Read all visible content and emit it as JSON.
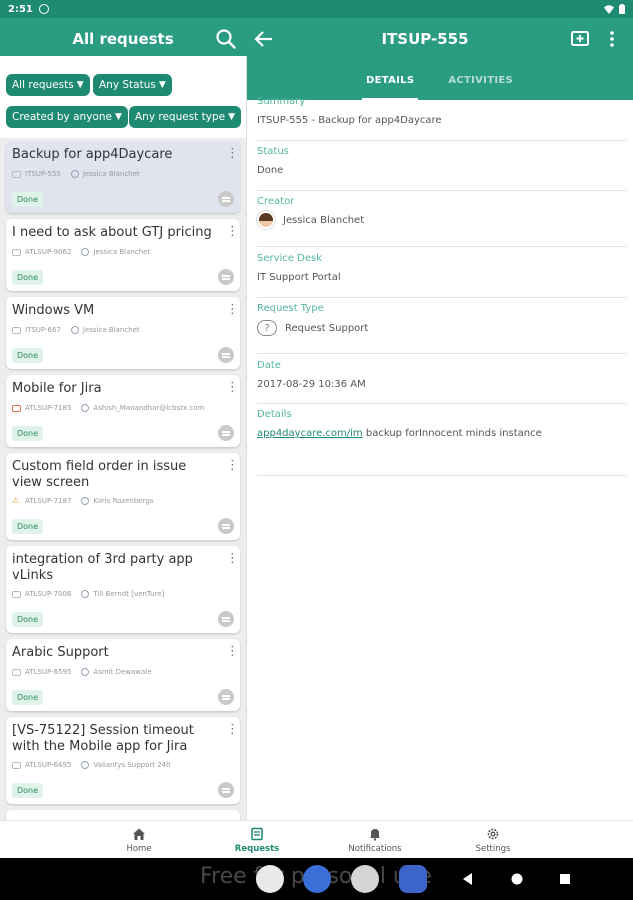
{
  "status_bar": {
    "time": "2:51"
  },
  "list_header": {
    "title": "All requests"
  },
  "detail_header": {
    "title": "ITSUP-555"
  },
  "tabs": [
    {
      "label": "DETAILS",
      "active": true
    },
    {
      "label": "ACTIVITIES",
      "active": false
    }
  ],
  "filters": [
    {
      "label": "All requests"
    },
    {
      "label": "Any Status"
    },
    {
      "label": "Created by anyone"
    },
    {
      "label": "Any request type"
    }
  ],
  "requests": [
    {
      "title": "Backup for app4Daycare",
      "key": "ITSUP-555",
      "person": "Jessica Blanchet",
      "status": "Done",
      "type_icon": "ticket-icon",
      "selected": true
    },
    {
      "title": "I need to ask about GTJ pricing",
      "key": "ATLSUP-9062",
      "person": "Jessica Blanchet",
      "status": "Done",
      "type_icon": "ticket-icon"
    },
    {
      "title": "Windows VM",
      "key": "ITSUP-667",
      "person": "Jessica Blanchet",
      "status": "Done",
      "type_icon": "ticket-icon"
    },
    {
      "title": "Mobile for Jira",
      "key": "ATLSUP-7185",
      "person": "Ashish_Manandhar@lcbstx.com",
      "status": "Done",
      "type_icon": "mail-icon"
    },
    {
      "title": "Custom field order in issue view screen",
      "key": "ATLSUP-7187",
      "person": "Kiiris Rozenbergs",
      "status": "Done",
      "type_icon": "warning-icon"
    },
    {
      "title": "integration of 3rd party app vLinks",
      "key": "ATLSUP-7006",
      "person": "Till Berndt [venTure]",
      "status": "Done",
      "type_icon": "ticket-icon"
    },
    {
      "title": "Arabic Support",
      "key": "ATLSUP-6595",
      "person": "Asmit Dewawale",
      "status": "Done",
      "type_icon": "ticket-icon"
    },
    {
      "title": "[VS-75122] Session timeout with the Mobile app for Jira",
      "key": "ATLSUP-6495",
      "person": "Valiantys Support 24h",
      "status": "Done",
      "type_icon": "ticket-icon"
    }
  ],
  "details": {
    "summary": {
      "label": "Summary",
      "value": "ITSUP-555 - Backup for app4Daycare"
    },
    "status": {
      "label": "Status",
      "value": "Done"
    },
    "creator": {
      "label": "Creator",
      "value": "Jessica Blanchet"
    },
    "service_desk": {
      "label": "Service Desk",
      "value": "IT Support Portal"
    },
    "request_type": {
      "label": "Request Type",
      "value": "Request Support"
    },
    "date": {
      "label": "Date",
      "value": "2017-08-29 10:36 AM"
    },
    "description": {
      "label": "Details",
      "link": "app4daycare.com/im",
      "text": " backup forInnocent minds instance"
    }
  },
  "bottom_nav": [
    {
      "label": "Home",
      "active": false
    },
    {
      "label": "Requests",
      "active": true
    },
    {
      "label": "Notifications",
      "active": false
    },
    {
      "label": "Settings",
      "active": false
    }
  ],
  "watermark": "Free for personal use",
  "colors": {
    "primary": "#2a9c82",
    "primary_dark": "#1f8a72",
    "label_teal": "#54b7a0",
    "done_badge_bg": "#e0f3ea"
  }
}
